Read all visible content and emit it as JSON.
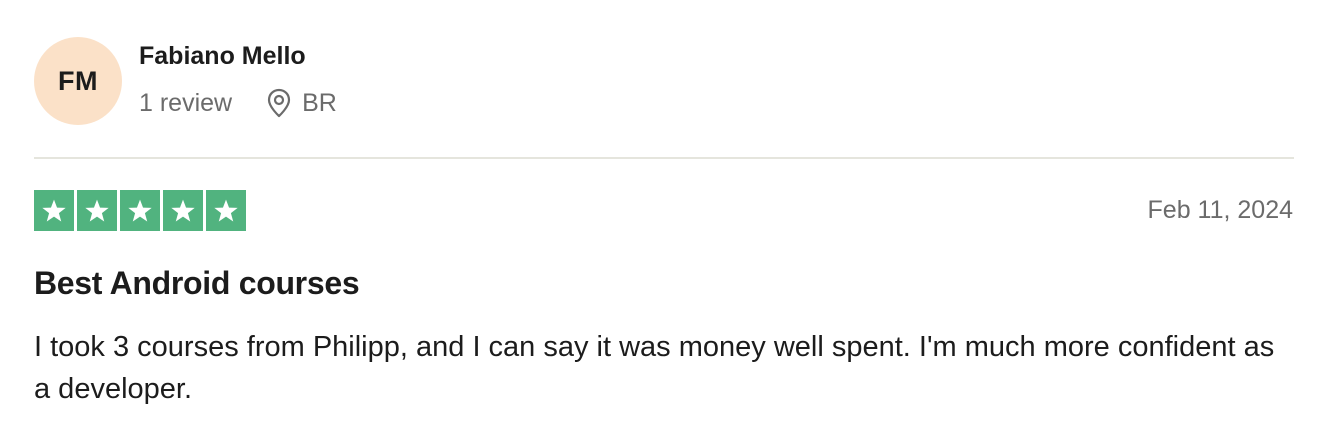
{
  "reviewer": {
    "initials": "FM",
    "name": "Fabiano Mello",
    "review_count": "1 review",
    "location": "BR",
    "location_icon": "map-pin-icon",
    "avatar_color": "#fbe1c8"
  },
  "review": {
    "rating": 5,
    "rating_max": 5,
    "star_color": "#51b37f",
    "date": "Feb 11, 2024",
    "title": "Best Android courses",
    "body": "I took 3 courses from Philipp, and I can say it was money well spent. I'm much more confident as a developer."
  }
}
